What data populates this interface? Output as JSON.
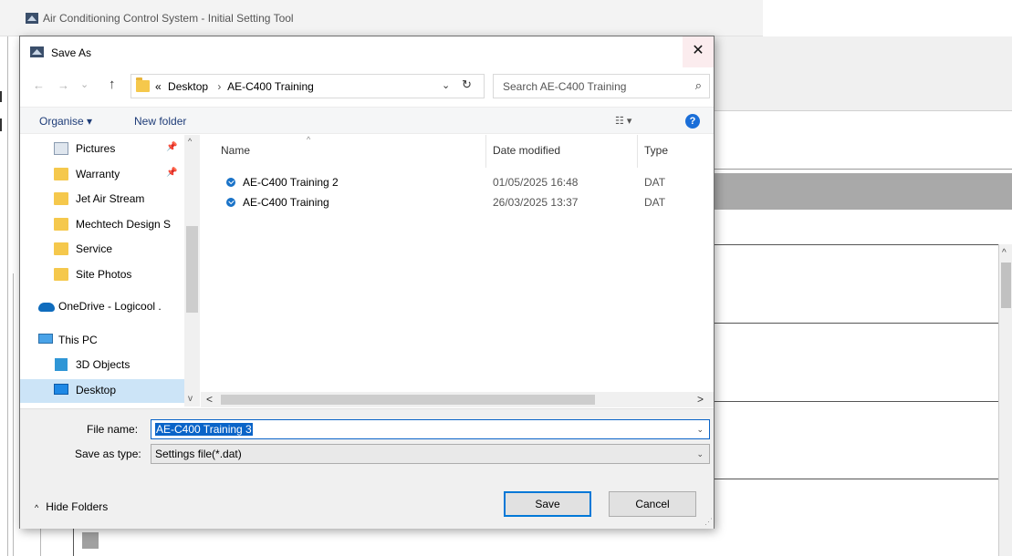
{
  "app": {
    "title": "Air Conditioning Control System - Initial Setting Tool"
  },
  "dialog": {
    "title": "Save As",
    "close_glyph": "✕",
    "nav": {
      "back_glyph": "←",
      "forward_glyph": "→",
      "recent_glyph": "⌄",
      "up_glyph": "↑",
      "breadcrumb_prefix": "«",
      "breadcrumb": [
        "Desktop",
        "AE-C400 Training"
      ],
      "crumb_separator": "›",
      "dropdown_glyph": "⌄",
      "refresh_glyph": "↻",
      "search_placeholder": "Search AE-C400 Training",
      "search_glyph": "⌕"
    },
    "commands": {
      "organise": "Organise ▾",
      "new_folder": "New folder",
      "view_glyph": "☷ ▾",
      "help_glyph": "?"
    },
    "navpane": {
      "items": [
        {
          "label": "Pictures",
          "icon": "pictures-icon",
          "pinned": true
        },
        {
          "label": "Warranty",
          "icon": "folder-icon",
          "pinned": true
        },
        {
          "label": "Jet Air Stream",
          "icon": "folder-icon",
          "pinned": false
        },
        {
          "label": "Mechtech Design S",
          "icon": "folder-icon",
          "pinned": false
        },
        {
          "label": "Service",
          "icon": "folder-icon",
          "pinned": false
        },
        {
          "label": "Site Photos",
          "icon": "folder-icon",
          "pinned": false
        },
        {
          "label": "OneDrive - Logicool .",
          "icon": "onedrive-icon",
          "pinned": false
        },
        {
          "label": "This PC",
          "icon": "this-pc-icon",
          "pinned": false
        },
        {
          "label": "3D Objects",
          "icon": "3d-objects-icon",
          "pinned": false
        },
        {
          "label": "Desktop",
          "icon": "desktop-icon",
          "pinned": false,
          "selected": true
        }
      ],
      "pin_glyph": "📌",
      "scroll_up_glyph": "^",
      "scroll_down_glyph": "v"
    },
    "filelist": {
      "columns": {
        "name": "Name",
        "date": "Date modified",
        "type": "Type"
      },
      "sort_glyph": "^",
      "rows": [
        {
          "name": "AE-C400 Training 2",
          "date": "01/05/2025 16:48",
          "type": "DAT"
        },
        {
          "name": "AE-C400 Training",
          "date": "26/03/2025 13:37",
          "type": "DAT"
        }
      ],
      "hscroll_left": "<",
      "hscroll_right": ">"
    },
    "form": {
      "file_name_label": "File name:",
      "file_name_value": "AE-C400 Training 3",
      "save_type_label": "Save as type:",
      "save_type_value": "Settings file(*.dat)",
      "dropdown_glyph": "⌄"
    },
    "footer": {
      "hide_folders_glyph": "^",
      "hide_folders": "Hide Folders",
      "save": "Save",
      "cancel": "Cancel",
      "grip": "⋰"
    },
    "colors": {
      "accent": "#0078d7",
      "selection": "#0a64c8",
      "nav_selected": "#cce4f7",
      "close_hover": "#fbecee"
    }
  }
}
